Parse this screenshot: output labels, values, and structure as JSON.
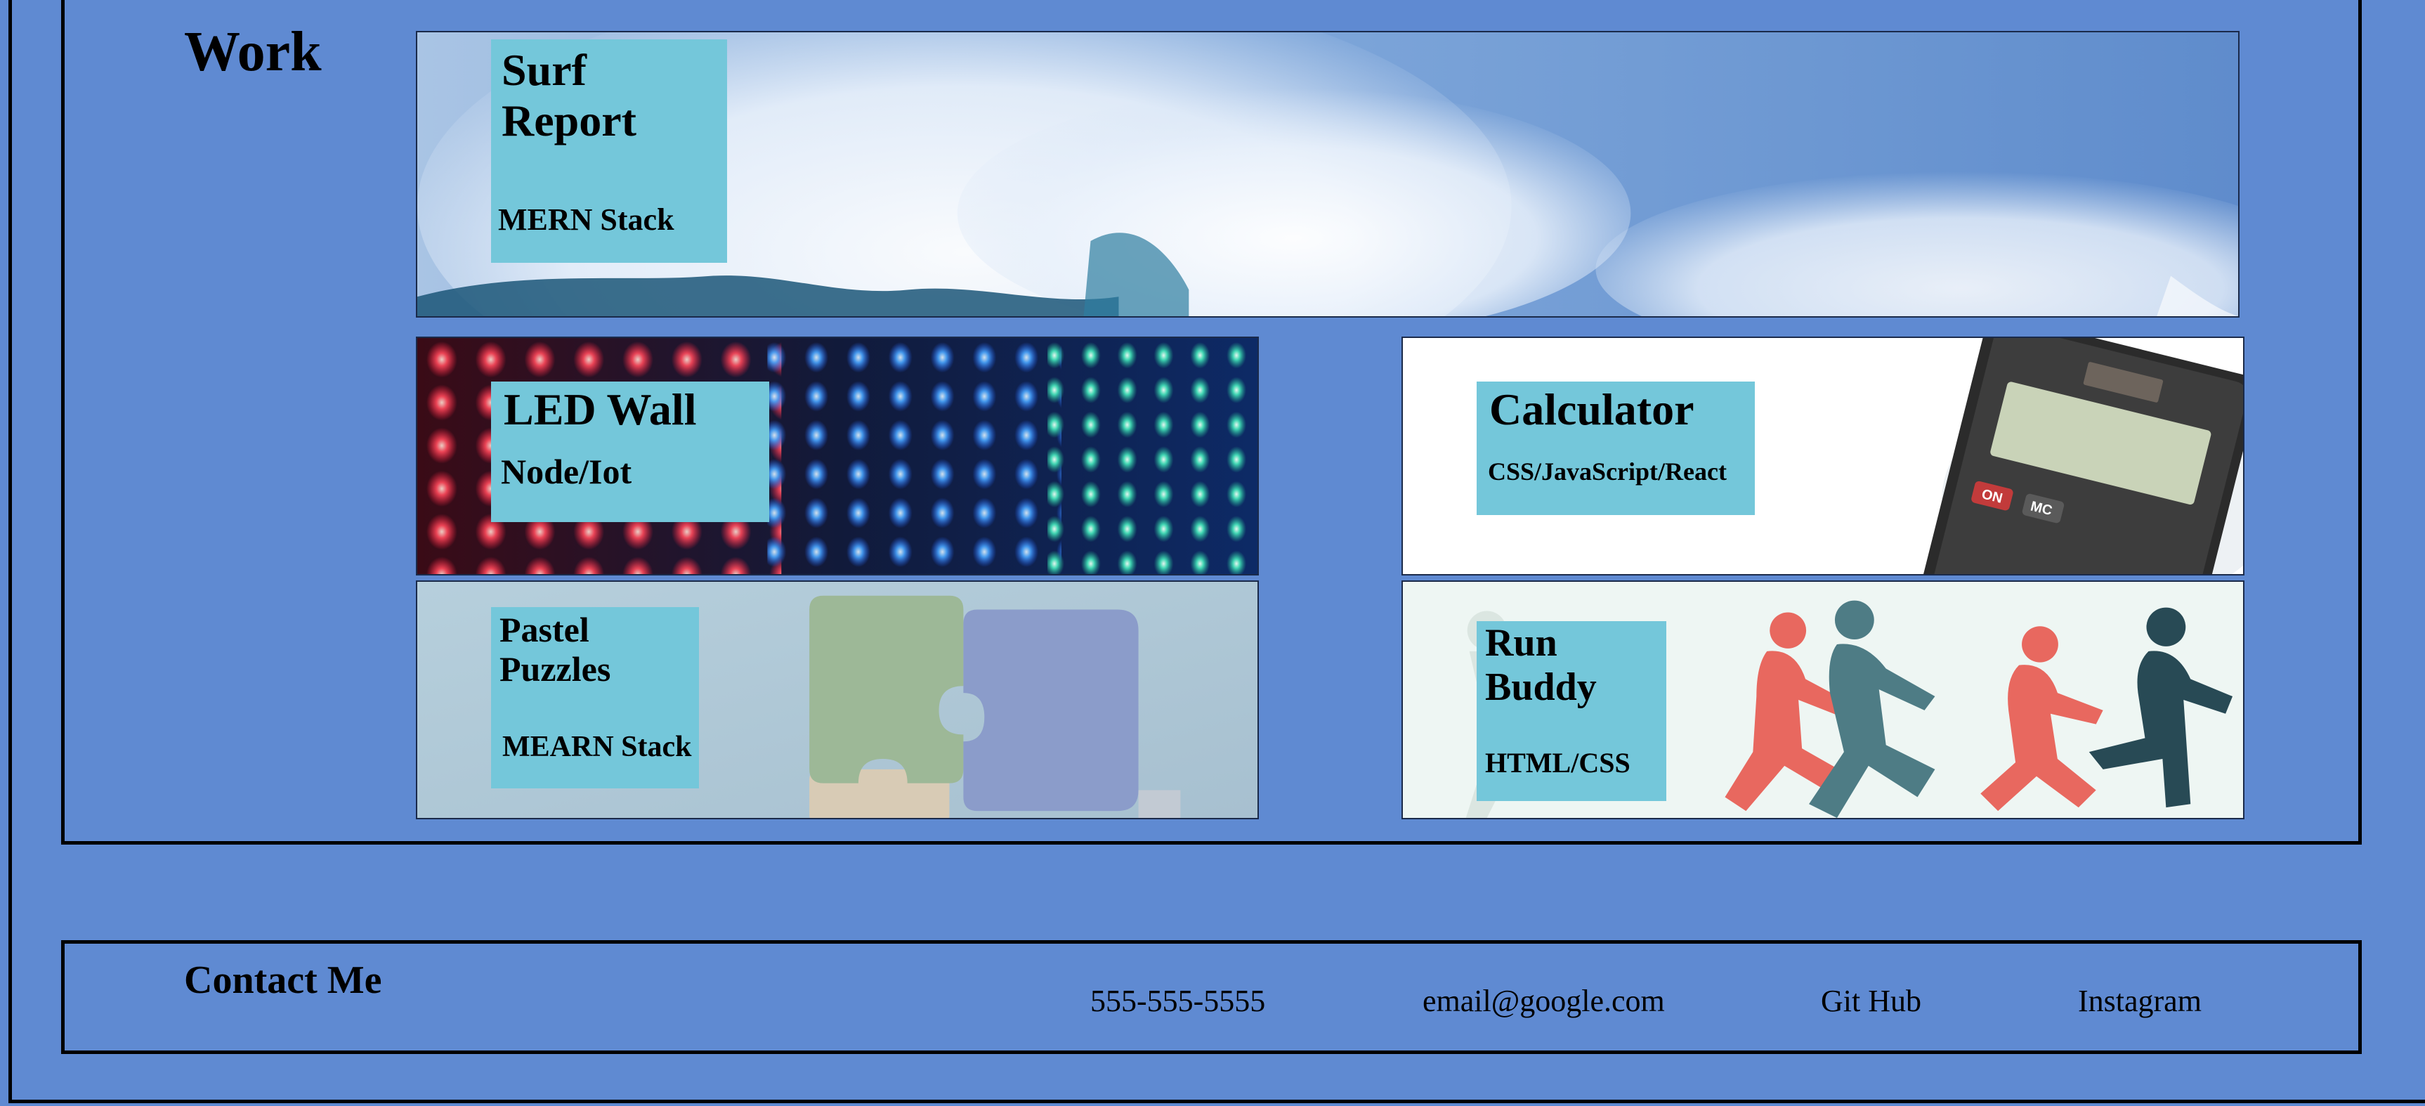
{
  "work": {
    "heading": "Work",
    "projects": [
      {
        "title": "Surf\nReport",
        "stack": "MERN Stack",
        "image": "ocean-wave"
      },
      {
        "title": "LED Wall",
        "stack": "Node/Iot",
        "image": "led-matrix"
      },
      {
        "title": "Calculator",
        "stack": "CSS/JavaScript/React",
        "image": "calculator"
      },
      {
        "title": "Pastel\nPuzzles",
        "stack": "MEARN Stack",
        "image": "puzzle-pieces"
      },
      {
        "title": "Run\nBuddy",
        "stack": "HTML/CSS",
        "image": "runners"
      }
    ]
  },
  "contact": {
    "heading": "Contact Me",
    "links": [
      "555-555-5555",
      "email@google.com",
      "Git Hub",
      "Instagram"
    ]
  },
  "colors": {
    "page_bg": "#5f8ad2",
    "label_bg": "#74c7da",
    "border": "#000000"
  }
}
